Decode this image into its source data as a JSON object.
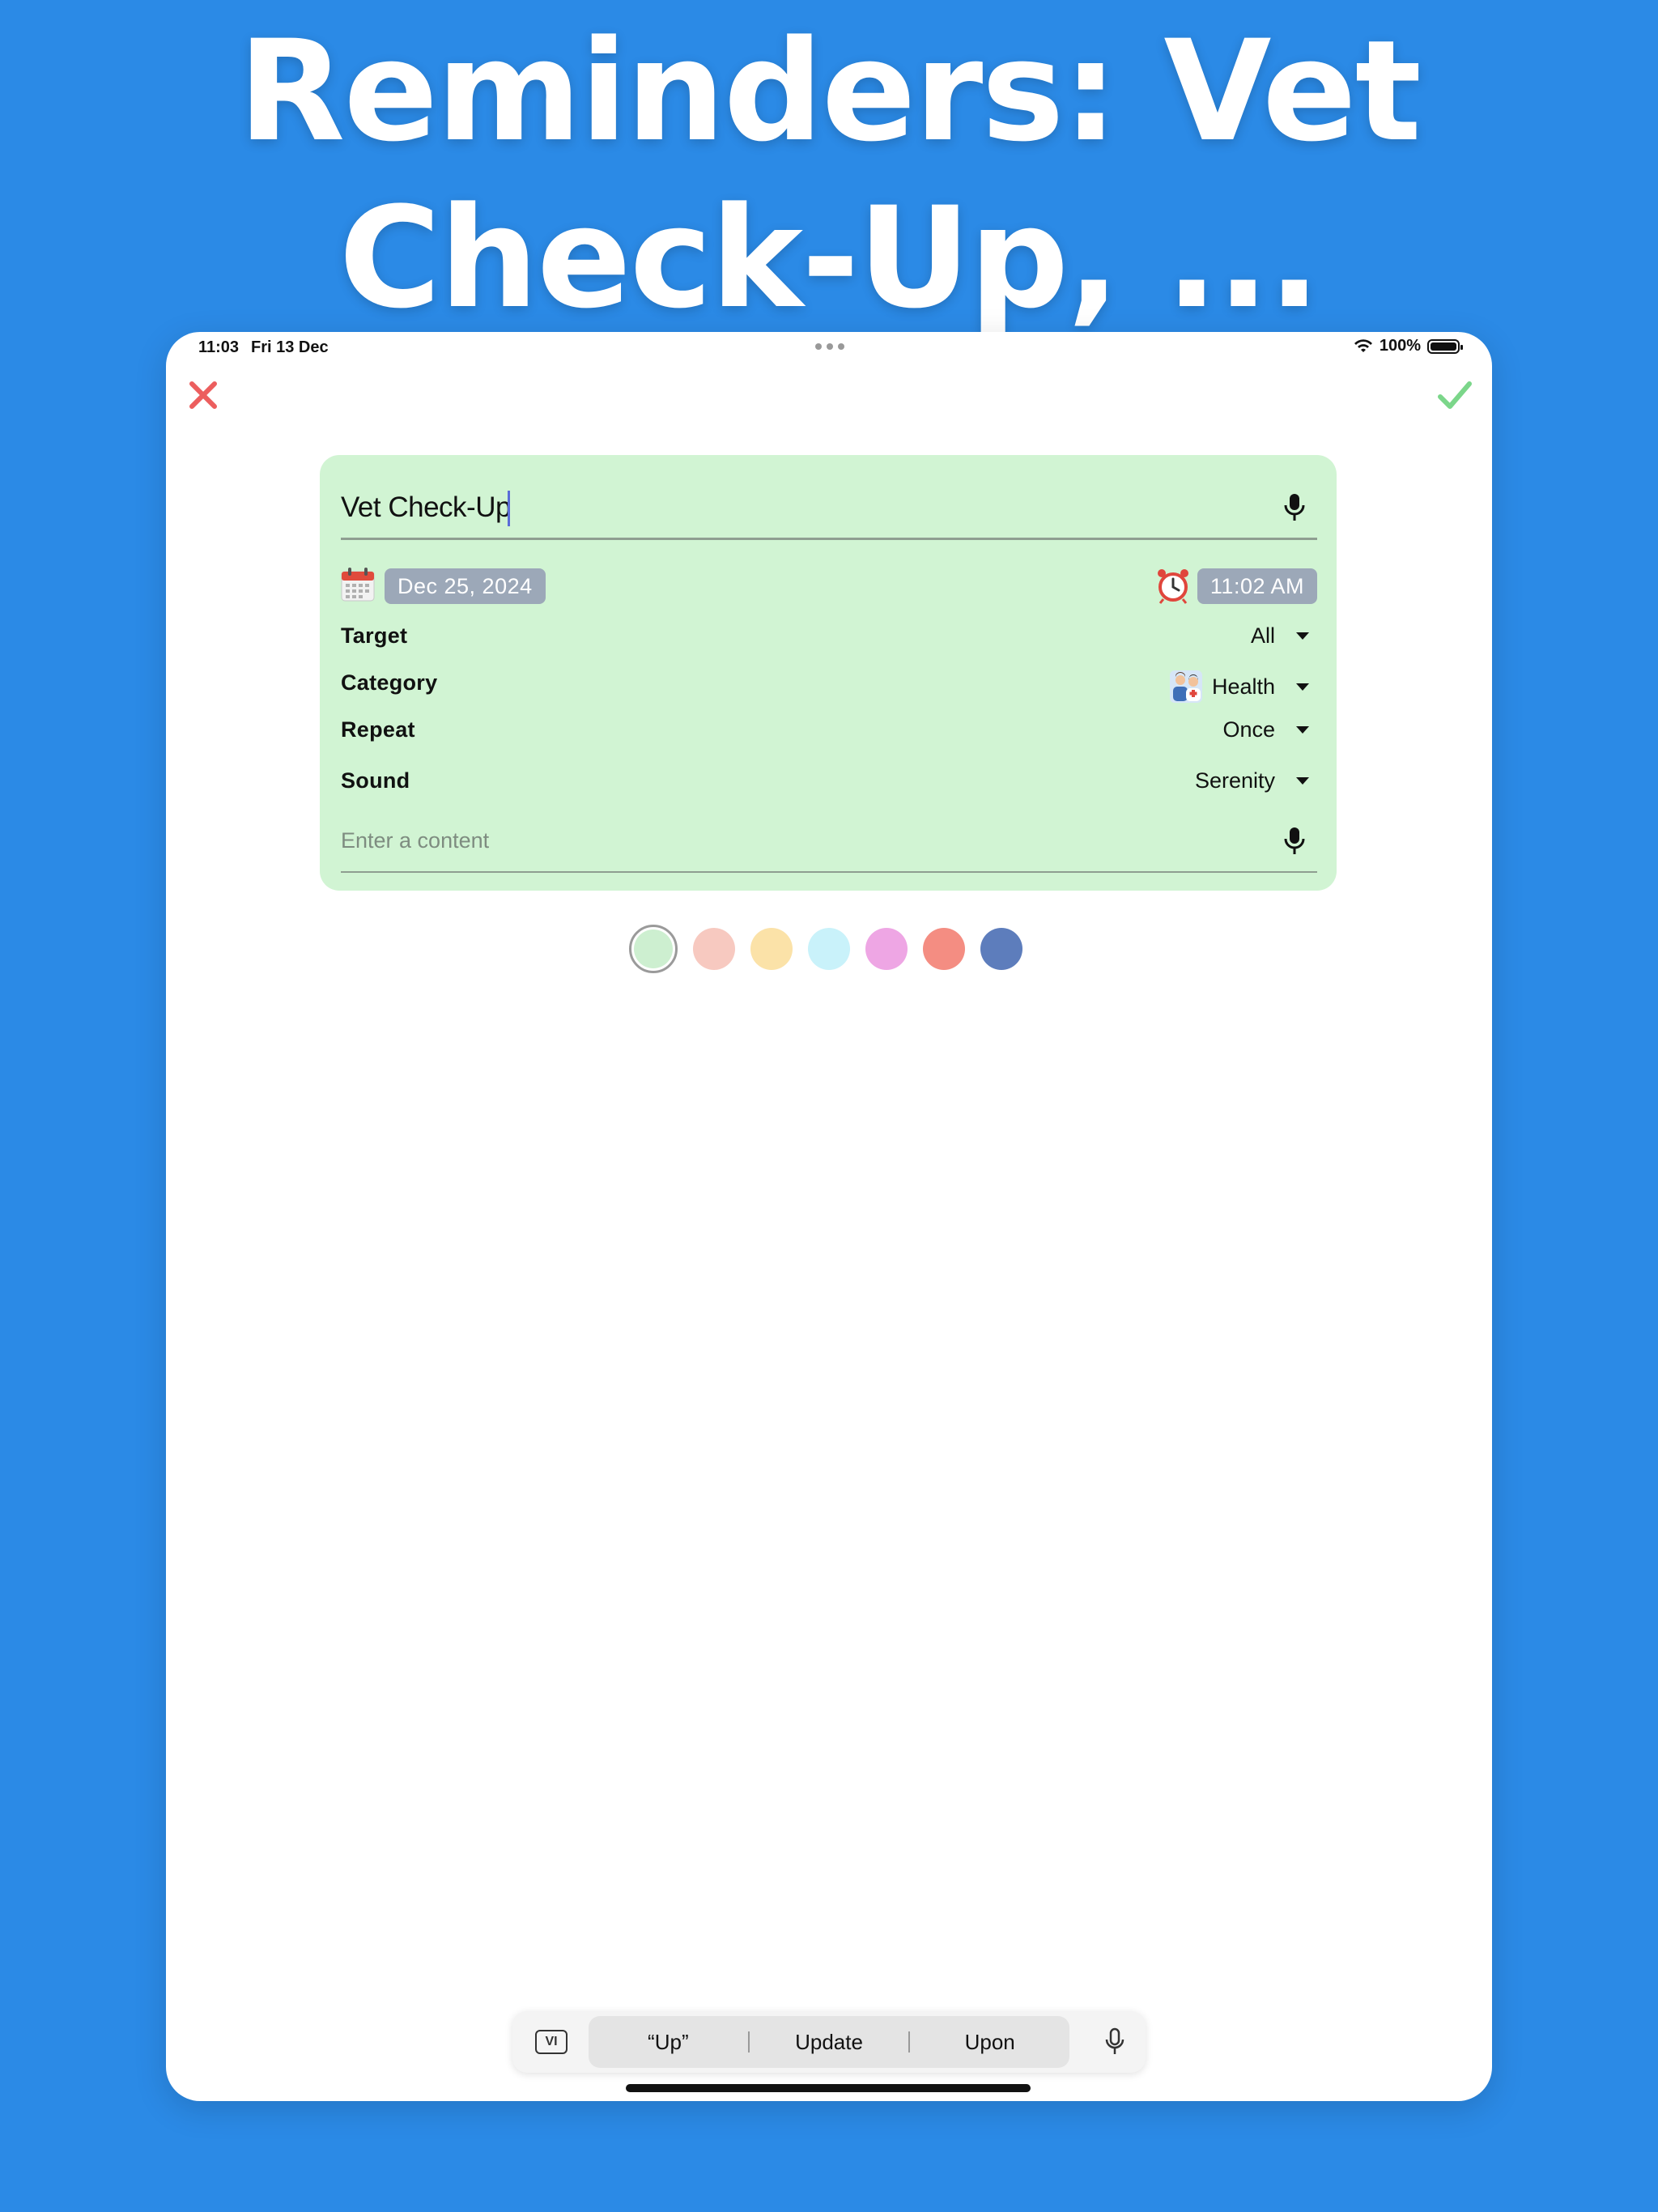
{
  "headline": {
    "line1": "Reminders: Vet",
    "line2": "Check-Up, ..."
  },
  "status_bar": {
    "time": "11:03",
    "date": "Fri 13 Dec",
    "battery": "100%"
  },
  "toolbar": {
    "close_icon": "close-icon",
    "save_icon": "checkmark-icon"
  },
  "form": {
    "title_value": "Vet Check-Up",
    "date": "Dec 25, 2024",
    "time": "11:02 AM",
    "settings": [
      {
        "label": "Target",
        "value": "All"
      },
      {
        "label": "Category",
        "value": "Health",
        "icon": "health-icon"
      },
      {
        "label": "Repeat",
        "value": "Once"
      },
      {
        "label": "Sound",
        "value": "Serenity"
      }
    ],
    "content_placeholder": "Enter a content"
  },
  "colors": {
    "accent_close": "#EC5E5E",
    "accent_save": "#7BD68A",
    "card_background": "#D1F4D3",
    "swatches": [
      "#CDEFD0",
      "#F7C9C0",
      "#FBE2A8",
      "#C9F2FA",
      "#EEA6E4",
      "#F48D82",
      "#5D7DBC"
    ],
    "selected_swatch": 0
  },
  "keyboard": {
    "language": "VI",
    "suggestions": [
      "“Up”",
      "Update",
      "Upon"
    ]
  }
}
